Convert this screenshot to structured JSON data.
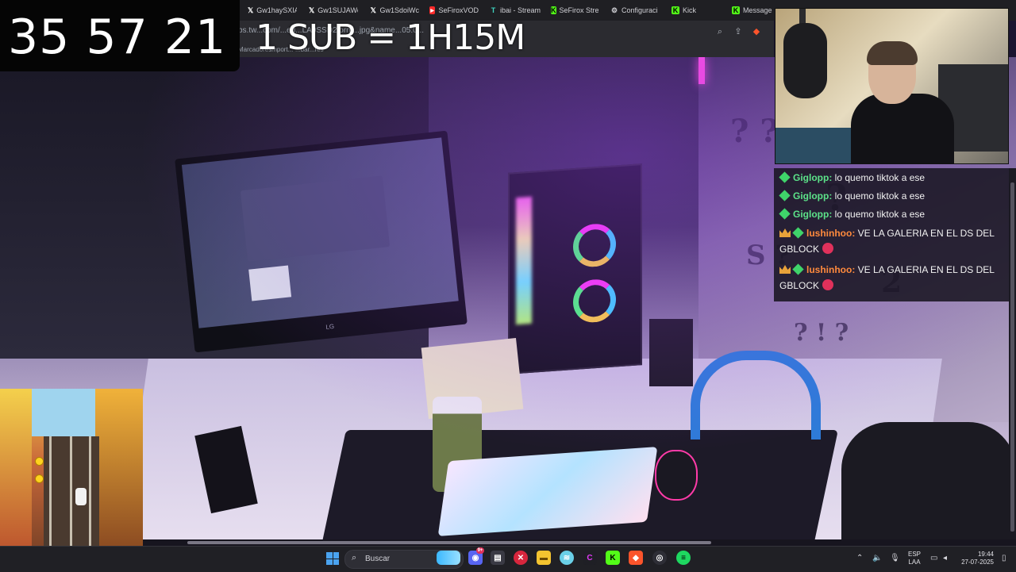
{
  "browser": {
    "tabs": [
      {
        "label": "Gw1haySXIA",
        "icon": "x-icon"
      },
      {
        "label": "Gw1SUJAWc",
        "icon": "x-icon"
      },
      {
        "label": "Gw1SdoiWc",
        "icon": "x-icon"
      },
      {
        "label": "SeFiroxVOD",
        "icon": "youtube-icon"
      },
      {
        "label": "ibai - Stream",
        "icon": "twitch-tracker-icon"
      },
      {
        "label": "SeFirox Stre",
        "icon": "kick-icon"
      },
      {
        "label": "Configuraci",
        "icon": "gear-icon"
      },
      {
        "label": "Kick",
        "icon": "kick-icon"
      },
      {
        "label": "Message",
        "icon": "kick-icon"
      }
    ],
    "url": "bs.tw...com/...ed...LA0SSD2form...jpg&name...05:0...",
    "bookmarks": [
      "Marcadores",
      "Import...",
      "...bar...res"
    ]
  },
  "overlay": {
    "timer": "35 57 21",
    "sub_rule": "1 SUB = 1H15M"
  },
  "chat": {
    "messages": [
      {
        "user": "Giglopp:",
        "text": "lo quemo tiktok a ese",
        "user_color": "#5ce389",
        "badges": [
          "gem"
        ],
        "emote": false
      },
      {
        "user": "Giglopp:",
        "text": "lo quemo tiktok a ese",
        "user_color": "#5ce389",
        "badges": [
          "gem"
        ],
        "emote": false
      },
      {
        "user": "Giglopp:",
        "text": "lo quemo tiktok a ese",
        "user_color": "#5ce389",
        "badges": [
          "gem"
        ],
        "emote": false
      },
      {
        "user": "lushinhoo:",
        "text": "VE LA GALERIA EN EL DS DEL GBLOCK",
        "user_color": "#ff8a3d",
        "badges": [
          "crown",
          "gem"
        ],
        "emote": true
      },
      {
        "user": "lushinhoo:",
        "text": "VE LA GALERIA EN EL DS DEL GBLOCK",
        "user_color": "#ff8a3d",
        "badges": [
          "crown",
          "gem"
        ],
        "emote": true
      }
    ]
  },
  "taskbar": {
    "search_placeholder": "Buscar",
    "apps": [
      "discord-icon",
      "notes-icon",
      "antivirus-icon",
      "file-explorer-icon",
      "wave-icon",
      "canva-icon",
      "kick-icon",
      "brave-icon",
      "obs-icon",
      "spotify-icon"
    ],
    "lang_line1": "ESP",
    "lang_line2": "LAA",
    "time": "19:44",
    "date": "27-07-2025",
    "discord_badge": "9+"
  },
  "colors": {
    "accent_green": "#3fd46a",
    "chat_bg": "#19161f",
    "taskbar_bg": "#202025",
    "neon_pink": "#ff4fd9"
  }
}
